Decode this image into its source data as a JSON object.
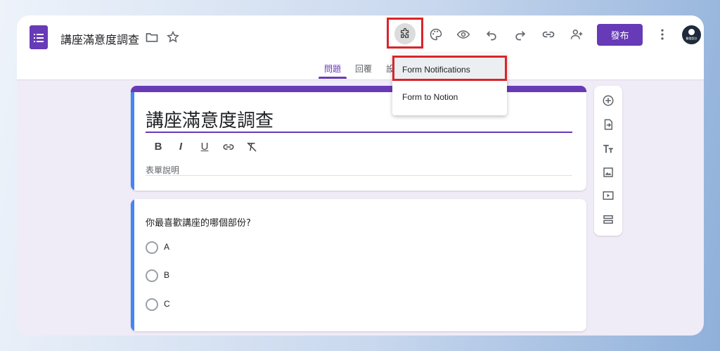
{
  "header": {
    "title": "講座滿意度調查",
    "publish_label": "發布",
    "avatar_text": "聯發設計"
  },
  "tabs": [
    {
      "label": "問題",
      "active": true
    },
    {
      "label": "回覆",
      "active": false
    },
    {
      "label": "設",
      "active": false
    }
  ],
  "addon_menu": {
    "items": [
      {
        "label": "Form Notifications",
        "highlighted": true
      },
      {
        "label": "Form to Notion",
        "highlighted": false
      }
    ]
  },
  "form": {
    "title": "講座滿意度調查",
    "description_placeholder": "表單說明",
    "format_tools": [
      "B",
      "I",
      "U",
      "link",
      "clear-format"
    ]
  },
  "question": {
    "text": "你最喜歡講座的哪個部份?",
    "options": [
      "A",
      "B",
      "C"
    ]
  },
  "side_toolbar": [
    "add-question",
    "import-questions",
    "add-title",
    "add-image",
    "add-video",
    "add-section"
  ],
  "colors": {
    "accent": "#673ab7",
    "highlight_border": "#d9252b",
    "card_edge": "#4285f4",
    "page_bg": "#efebf7"
  }
}
